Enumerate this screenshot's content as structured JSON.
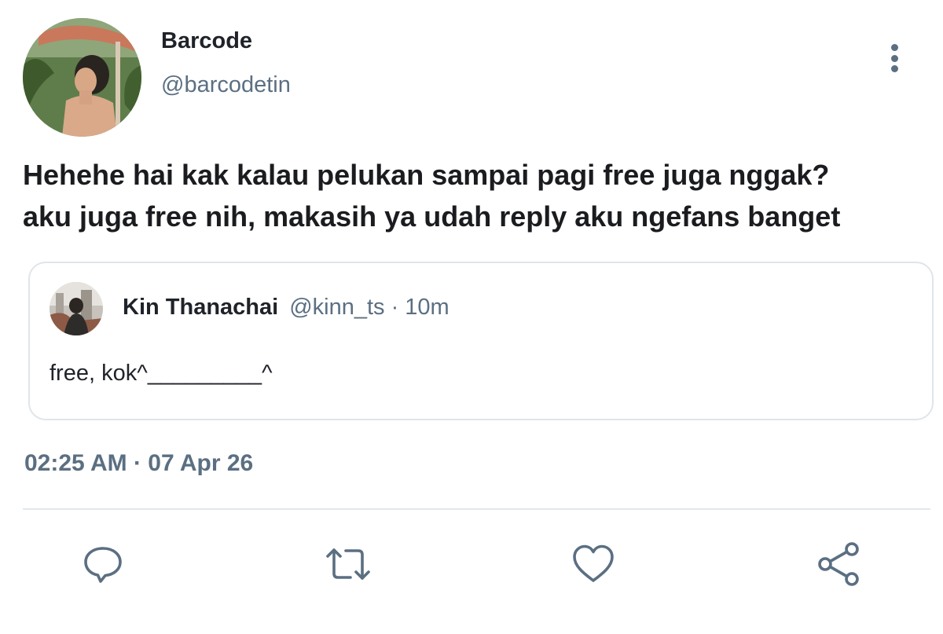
{
  "author": {
    "display_name": "Barcode",
    "handle": "@barcodetin",
    "avatar_icon": "user-avatar-photo"
  },
  "tweet": {
    "text": "Hehehe hai kak kalau pelukan sampai pagi free juga nggak?\naku juga free nih, makasih ya udah reply aku ngefans banget",
    "timestamp": "02:25 AM · 07 Apr 26"
  },
  "quoted_tweet": {
    "display_name": "Kin Thanachai",
    "meta": "@kinn_ts · 10m",
    "text": "free, kok^_________^",
    "avatar_icon": "user-avatar-photo"
  },
  "actions": {
    "reply_icon": "reply-icon",
    "retweet_icon": "retweet-icon",
    "like_icon": "heart-icon",
    "share_icon": "share-icon"
  },
  "colors": {
    "primary_text": "#1f2329",
    "secondary_text": "#5b6f82",
    "border": "#dfe5ea",
    "icon": "#5b6f82"
  }
}
